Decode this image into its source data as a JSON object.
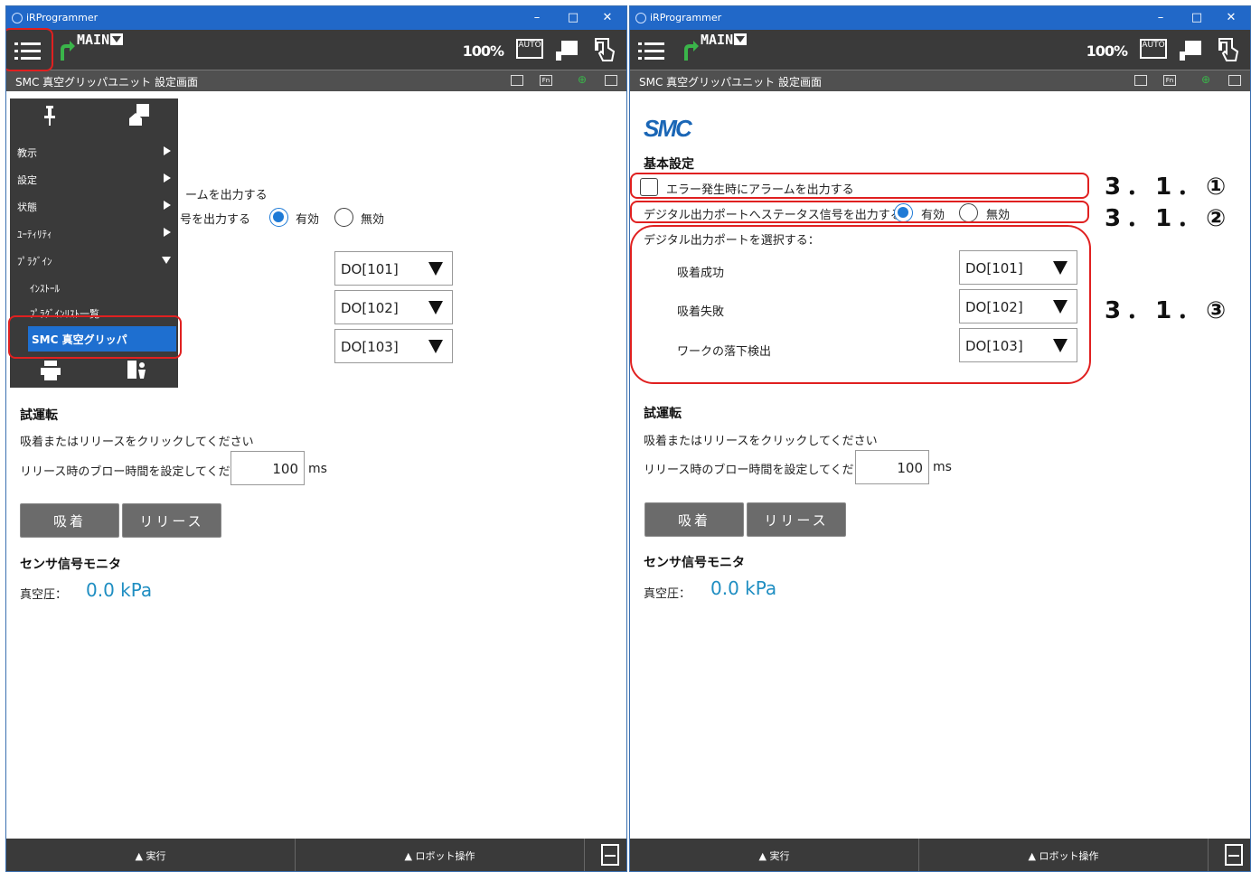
{
  "app": {
    "title": "iRProgrammer",
    "program": "MAIN",
    "zoom": "100%",
    "auto_label": "AUTO",
    "screen_title": "SMC 真空グリッパユニット 設定画面",
    "minimize": "–",
    "maximize": "□",
    "close": "✕"
  },
  "subbar": {
    "fn_label": "Fn"
  },
  "menu": {
    "items": [
      {
        "label": "教示"
      },
      {
        "label": "設定"
      },
      {
        "label": "状態"
      },
      {
        "label": "ﾕｰﾃｨﾘﾃｨ"
      },
      {
        "label": "ﾌﾟﾗｸﾞｲﾝ"
      }
    ],
    "sub_items": [
      {
        "label": "ｲﾝｽﾄｰﾙ"
      },
      {
        "label": "ﾌﾟﾗｸﾞｲﾝﾘｽﾄ一覧"
      }
    ],
    "selected": "SMC 真空グリッパ"
  },
  "left_partial": {
    "alarm_text": "ームを出力する",
    "status_text": "号を出力する"
  },
  "settings": {
    "logo": "SMC",
    "section_basic": "基本設定",
    "alarm_label": "エラー発生時にアラームを出力する",
    "status_label": "デジタル出力ポートへステータス信号を出力する",
    "enable": "有効",
    "disable": "無効",
    "select_port_label": "デジタル出力ポートを選択する：",
    "ports": [
      {
        "label": "吸着成功",
        "value": "DO[101]"
      },
      {
        "label": "吸着失敗",
        "value": "DO[102]"
      },
      {
        "label": "ワークの落下検出",
        "value": "DO[103]"
      }
    ]
  },
  "trial": {
    "section": "試運転",
    "instruction": "吸着またはリリースをクリックしてください",
    "blow_label": "リリース時のブロー時間を設定してください",
    "blow_value": "100",
    "unit": "ms",
    "suction_button": "吸着",
    "release_button": "リリース"
  },
  "monitor": {
    "section": "センサ信号モニタ",
    "vacuum_label": "真空圧：",
    "vacuum_value": "0.0 kPa"
  },
  "bottom": {
    "run": "▲ 実行",
    "robot": "▲ ロボット操作"
  },
  "annotations": {
    "a1": "3．1．①",
    "a2": "3．1．②",
    "a3": "3．1．③"
  }
}
